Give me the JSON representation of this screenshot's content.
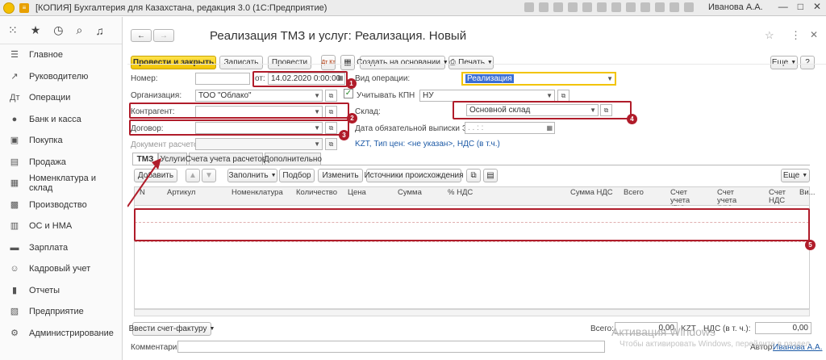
{
  "titlebar": {
    "menu_glyph": "≡",
    "title": "[КОПИЯ] Бухгалтерия для Казахстана, редакция 3.0  (1С:Предприятие)",
    "user": "Иванова А.А.",
    "minimize": "—",
    "maximize": "□",
    "close": "✕"
  },
  "sidebar": {
    "items": [
      {
        "icon": "☰",
        "label": "Главное"
      },
      {
        "icon": "↗",
        "label": "Руководителю"
      },
      {
        "icon": "Дт",
        "label": "Операции"
      },
      {
        "icon": "●",
        "label": "Банк и касса"
      },
      {
        "icon": "▣",
        "label": "Покупка"
      },
      {
        "icon": "▤",
        "label": "Продажа"
      },
      {
        "icon": "▦",
        "label": "Номенклатура и склад"
      },
      {
        "icon": "▩",
        "label": "Производство"
      },
      {
        "icon": "▥",
        "label": "ОС и НМА"
      },
      {
        "icon": "▬",
        "label": "Зарплата"
      },
      {
        "icon": "☺",
        "label": "Кадровый учет"
      },
      {
        "icon": "▮",
        "label": "Отчеты"
      },
      {
        "icon": "▧",
        "label": "Предприятие"
      },
      {
        "icon": "⚙",
        "label": "Администрирование"
      }
    ]
  },
  "doc": {
    "back": "←",
    "forward": "→",
    "title": "Реализация ТМЗ и услуг: Реализация. Новый",
    "star": "☆",
    "more_vert": "⋮",
    "close": "✕"
  },
  "toolbar": {
    "post_close": "Провести и закрыть",
    "save": "Записать",
    "post": "Провести",
    "dt_kt": "Дт Кт",
    "create_based": "Создать на основании",
    "print": "Печать",
    "more": "Еще",
    "help": "?"
  },
  "form": {
    "number_label": "Номер:",
    "number_value": "",
    "date_label": "от:",
    "date_value": "14.02.2020  0:00:00",
    "optype_label": "Вид операции:",
    "optype_value": "Реализация",
    "org_label": "Организация:",
    "org_value": "ТОО \"Облако\"",
    "kpn_label": "Учитывать КПН",
    "kpn_value": "НУ",
    "counterparty_label": "Контрагент:",
    "counterparty_value": "",
    "warehouse_label": "Склад:",
    "warehouse_value": "Основной склад",
    "contract_label": "Договор:",
    "contract_value": "",
    "esf_label": "Дата обязательной выписки ЭСФ:",
    "esf_value": "  .  .       :  :",
    "settle_label": "Документ расчетов:",
    "settle_value": "",
    "price_info": "KZT, Тип цен: <не указан>, НДС (в т.ч.)"
  },
  "tabs": [
    "ТМЗ",
    "Услуги",
    "Счета учета расчетов",
    "Дополнительно"
  ],
  "grid_toolbar": {
    "add": "Добавить",
    "fill": "Заполнить",
    "pick": "Подбор",
    "edit": "Изменить",
    "sources": "Источники происхождения",
    "more": "Еще"
  },
  "grid_columns": [
    "N",
    "Артикул",
    "Номенклатура",
    "Количество",
    "Цена",
    "Сумма",
    "% НДС",
    "Сумма НДС",
    "Всего",
    "Счет учета (БУ)",
    "Счет учета (НУ)",
    "Счет НДС",
    "Ви..."
  ],
  "footer": {
    "invoice_button": "Ввести счет-фактуру",
    "total_label": "Всего:",
    "total_value": "0,00",
    "currency": "KZT",
    "vat_label": "НДС (в т. ч.):",
    "vat_value": "0,00",
    "comment_label": "Комментарий:",
    "author_label": "Автор:",
    "author_value": "Иванова А.А."
  },
  "watermark": {
    "line1": "Активация Windows",
    "line2": "Чтобы активировать Windows, перейдите в раздел"
  },
  "annotations": [
    "1",
    "2",
    "3",
    "4",
    "5"
  ],
  "colors": {
    "annotation": "#b01c2a",
    "primary_button": "#f2c400",
    "link": "#1d5aa6"
  }
}
